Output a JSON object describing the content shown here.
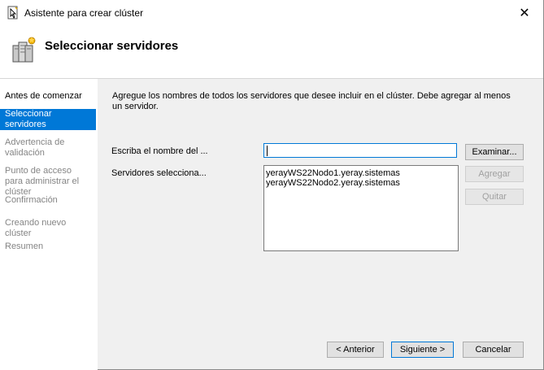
{
  "window": {
    "title": "Asistente para crear clúster",
    "close_glyph": "✕"
  },
  "header": {
    "title": "Seleccionar servidores",
    "icon": "server-cluster-icon"
  },
  "sidebar": {
    "items": [
      {
        "label": "Antes de comenzar",
        "state": "done"
      },
      {
        "label": "Seleccionar servidores",
        "state": "active"
      },
      {
        "label": "Advertencia de validación",
        "state": "pending"
      },
      {
        "label": "Punto de acceso para administrar el clúster",
        "state": "pending"
      },
      {
        "label": "Confirmación",
        "state": "pending"
      },
      {
        "label": "Creando nuevo clúster",
        "state": "pending"
      },
      {
        "label": "Resumen",
        "state": "pending"
      }
    ]
  },
  "main": {
    "description": "Agregue los nombres de todos los servidores que desee incluir en el clúster. Debe agregar al menos un servidor.",
    "server_name_label": "Escriba el nombre del ...",
    "server_name_value": "",
    "selected_label": "Servidores selecciona...",
    "selected_servers": [
      "yerayWS22Nodo1.yeray.sistemas",
      "yerayWS22Nodo2.yeray.sistemas"
    ],
    "browse_label": "Examinar...",
    "add_label": "Agregar",
    "remove_label": "Quitar"
  },
  "footer": {
    "back_label": "< Anterior",
    "next_label": "Siguiente >",
    "cancel_label": "Cancelar"
  },
  "colors": {
    "accent": "#0078d7",
    "disabled_text": "#a0a0a0",
    "pending_text": "#858585"
  }
}
